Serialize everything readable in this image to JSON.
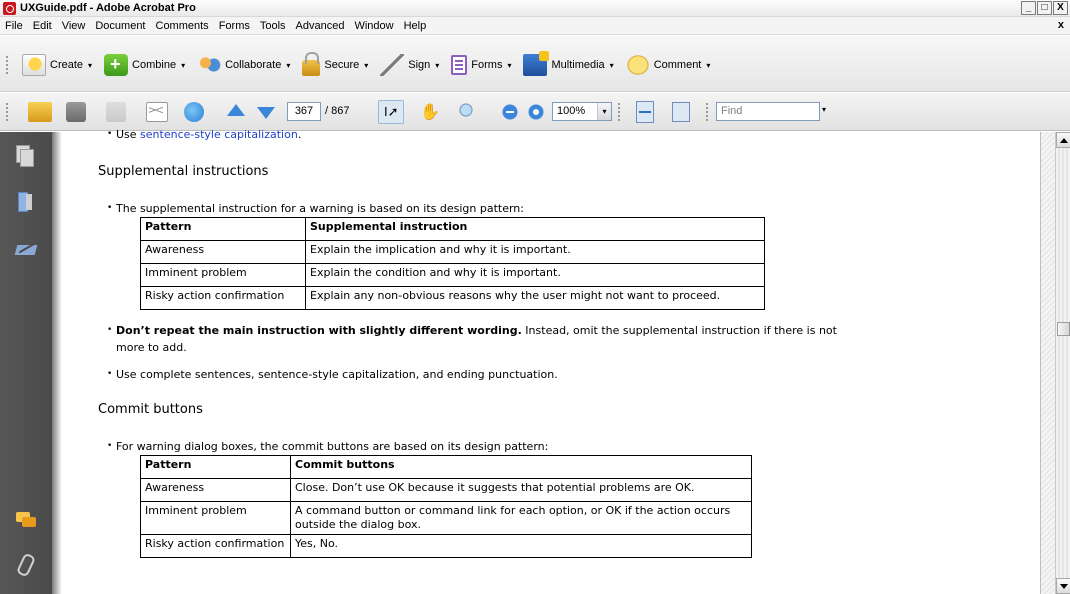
{
  "window": {
    "title": "UXGuide.pdf - Adobe Acrobat Pro",
    "controls": [
      "_",
      "□",
      "X"
    ],
    "menu_close": "x"
  },
  "menu": {
    "items": [
      "File",
      "Edit",
      "View",
      "Document",
      "Comments",
      "Forms",
      "Tools",
      "Advanced",
      "Window",
      "Help"
    ]
  },
  "tasks_toolbar": {
    "items": [
      {
        "label": "Create",
        "icon": "create-icon"
      },
      {
        "label": "Combine",
        "icon": "combine-icon"
      },
      {
        "label": "Collaborate",
        "icon": "collaborate-icon"
      },
      {
        "label": "Secure",
        "icon": "lock-icon"
      },
      {
        "label": "Sign",
        "icon": "pen-icon"
      },
      {
        "label": "Forms",
        "icon": "forms-icon"
      },
      {
        "label": "Multimedia",
        "icon": "multimedia-icon"
      },
      {
        "label": "Comment",
        "icon": "comment-icon"
      }
    ],
    "dropdown_glyph": "▾"
  },
  "nav_toolbar": {
    "current_page": "367",
    "total_pages": "/ 867",
    "zoom": "100%",
    "find_placeholder": "Find",
    "dropdown_glyph": "▾",
    "select_tool_glyph": "I➚"
  },
  "document": {
    "top_bullet_prefix": "Use ",
    "top_bullet_link": "sentence-style capitalization",
    "top_bullet_suffix": ".",
    "sections": [
      {
        "heading": "Supplemental instructions",
        "intro": "The supplemental instruction for a warning is based on its design pattern:",
        "table": {
          "headers": [
            "Pattern",
            "Supplemental instruction"
          ],
          "rows": [
            [
              "Awareness",
              "Explain the implication and why it is important."
            ],
            [
              "Imminent problem",
              "Explain the condition and why it is important."
            ],
            [
              "Risky action confirmation",
              "Explain any non-obvious reasons why the user might not want to proceed."
            ]
          ]
        },
        "bullets_after": [
          {
            "bold": "Don’t repeat the main instruction with slightly different wording.",
            "text": " Instead, omit the supplemental instruction if there is not more to add."
          },
          {
            "bold": "",
            "text": "Use complete sentences, sentence-style capitalization, and ending punctuation."
          }
        ]
      },
      {
        "heading": "Commit buttons",
        "intro": "For warning dialog boxes, the commit buttons are based on its design pattern:",
        "table": {
          "headers": [
            "Pattern",
            "Commit buttons"
          ],
          "rows": [
            [
              "Awareness",
              "Close. Don’t use OK because it suggests that potential problems are OK."
            ],
            [
              "Imminent problem",
              "A command button or command link for each option, or OK if the action occurs outside the dialog box."
            ],
            [
              "Risky action confirmation",
              "Yes, No."
            ]
          ]
        }
      }
    ]
  },
  "scrollbar": {
    "position_fraction": 0.42
  }
}
